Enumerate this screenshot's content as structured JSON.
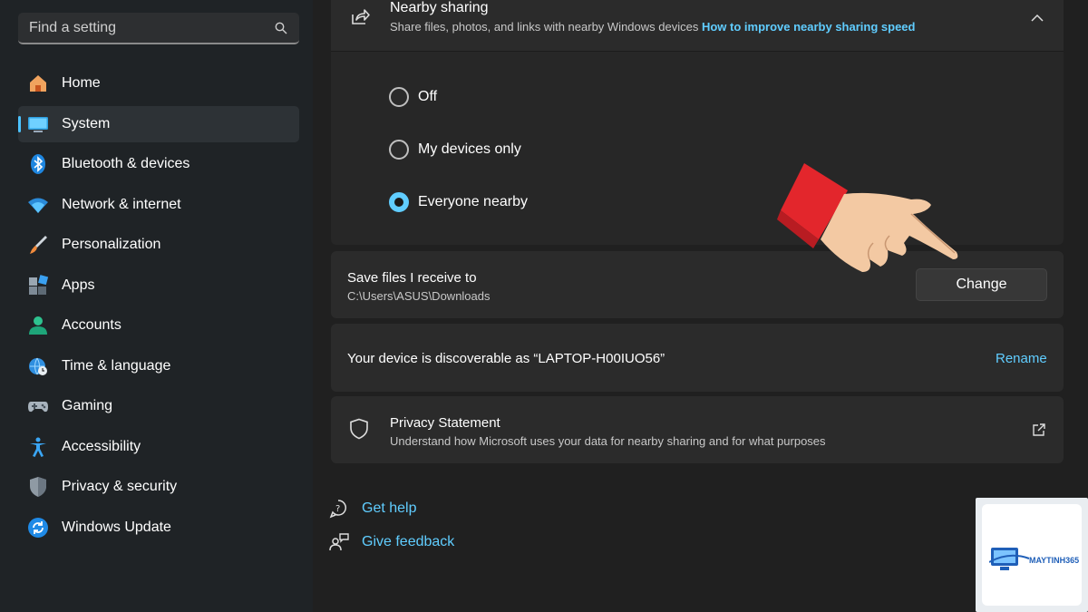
{
  "sidebar": {
    "search_placeholder": "Find a setting",
    "items": [
      {
        "label": "Home",
        "icon": "home-icon"
      },
      {
        "label": "System",
        "icon": "system-icon",
        "active": true
      },
      {
        "label": "Bluetooth & devices",
        "icon": "bluetooth-icon"
      },
      {
        "label": "Network & internet",
        "icon": "wifi-icon"
      },
      {
        "label": "Personalization",
        "icon": "brush-icon"
      },
      {
        "label": "Apps",
        "icon": "apps-icon"
      },
      {
        "label": "Accounts",
        "icon": "account-icon"
      },
      {
        "label": "Time & language",
        "icon": "globe-clock-icon"
      },
      {
        "label": "Gaming",
        "icon": "gamepad-icon"
      },
      {
        "label": "Accessibility",
        "icon": "accessibility-icon"
      },
      {
        "label": "Privacy & security",
        "icon": "shield-icon"
      },
      {
        "label": "Windows Update",
        "icon": "update-icon"
      }
    ]
  },
  "nearby": {
    "title": "Nearby sharing",
    "subtitle": "Share files, photos, and links with nearby Windows devices",
    "link": "How to improve nearby sharing speed",
    "options": [
      {
        "label": "Off",
        "checked": false
      },
      {
        "label": "My devices only",
        "checked": false
      },
      {
        "label": "Everyone nearby",
        "checked": true
      }
    ]
  },
  "save_files": {
    "title": "Save files I receive to",
    "path": "C:\\Users\\ASUS\\Downloads",
    "button": "Change"
  },
  "discoverable": {
    "text": "Your device is discoverable as “LAPTOP-H00IUO56”",
    "action": "Rename"
  },
  "privacy": {
    "title": "Privacy Statement",
    "subtitle": "Understand how Microsoft uses your data for nearby sharing and for what purposes"
  },
  "footer": {
    "help": "Get help",
    "feedback": "Give feedback"
  },
  "watermark": {
    "brand": "MAYTINH365"
  },
  "colors": {
    "accent": "#60cdff",
    "background": "#202020",
    "card": "#2b2b2b"
  }
}
